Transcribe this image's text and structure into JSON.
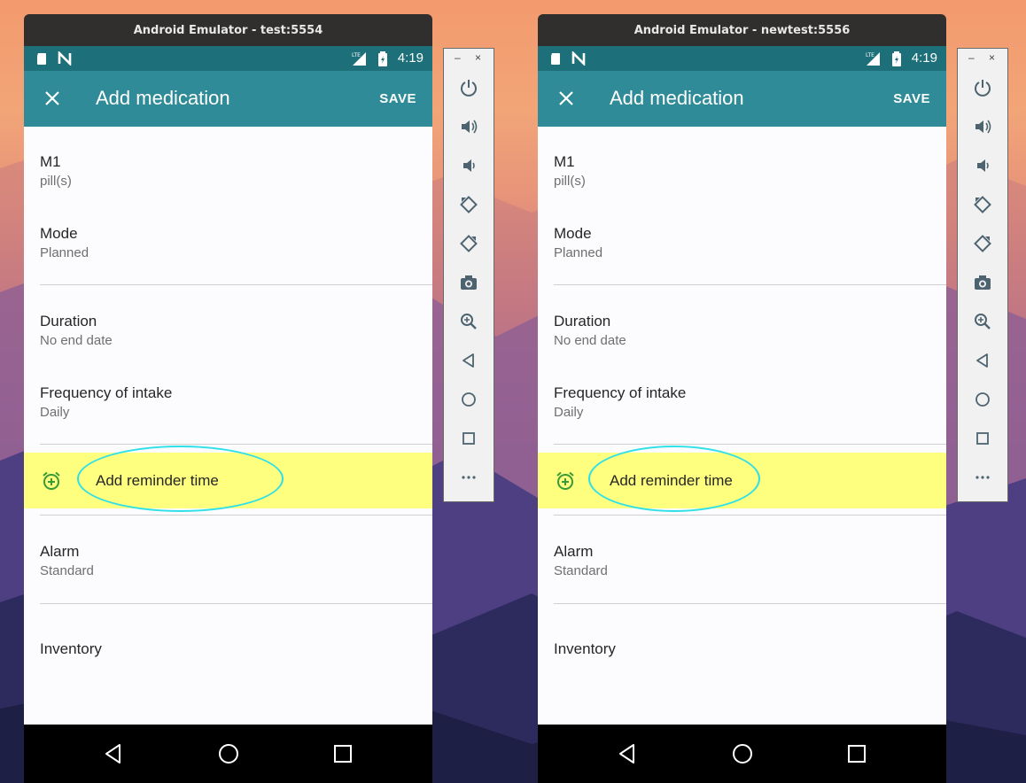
{
  "emulators": [
    {
      "window_title": "Android Emulator - test:5554",
      "status": {
        "time": "4:19",
        "network": "LTE"
      },
      "app_bar": {
        "title": "Add medication",
        "save": "SAVE"
      },
      "fields": {
        "name": {
          "primary": "M1",
          "secondary": "pill(s)"
        },
        "mode": {
          "primary": "Mode",
          "secondary": "Planned"
        },
        "duration": {
          "primary": "Duration",
          "secondary": "No end date"
        },
        "frequency": {
          "primary": "Frequency of intake",
          "secondary": "Daily"
        },
        "reminder": {
          "label": "Add reminder time"
        },
        "alarm": {
          "primary": "Alarm",
          "secondary": "Standard"
        },
        "inventory": {
          "primary": "Inventory"
        }
      }
    },
    {
      "window_title": "Android Emulator - newtest:5556",
      "status": {
        "time": "4:19",
        "network": "LTE"
      },
      "app_bar": {
        "title": "Add medication",
        "save": "SAVE"
      },
      "fields": {
        "name": {
          "primary": "M1",
          "secondary": "pill(s)"
        },
        "mode": {
          "primary": "Mode",
          "secondary": "Planned"
        },
        "duration": {
          "primary": "Duration",
          "secondary": "No end date"
        },
        "frequency": {
          "primary": "Frequency of intake",
          "secondary": "Daily"
        },
        "reminder": {
          "label": "Add reminder time"
        },
        "alarm": {
          "primary": "Alarm",
          "secondary": "Standard"
        },
        "inventory": {
          "primary": "Inventory"
        }
      }
    }
  ],
  "side_toolbar": {
    "window_controls": {
      "minimize": "–",
      "close": "×"
    },
    "buttons": [
      "power-icon",
      "volume-up-icon",
      "volume-down-icon",
      "rotate-left-icon",
      "rotate-right-icon",
      "camera-icon",
      "zoom-icon",
      "back-icon",
      "home-icon",
      "overview-icon",
      "more-icon"
    ]
  },
  "colors": {
    "status_bar": "#1d6f79",
    "app_bar": "#2f8b97",
    "highlight": "#ffff7f",
    "annotation_ring": "#2ee0e8",
    "alarm_icon": "#3a9a3a"
  }
}
